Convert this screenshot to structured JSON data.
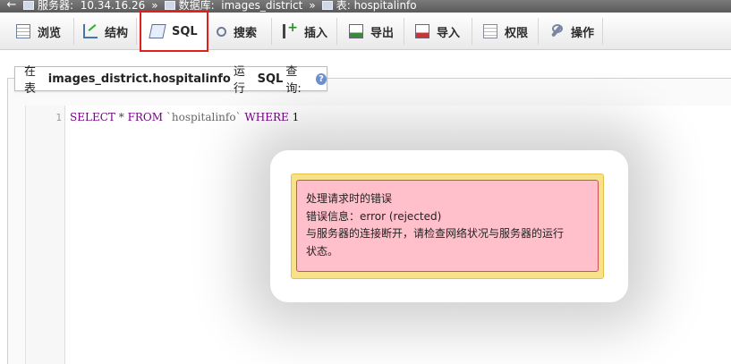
{
  "breadcrumb": {
    "back_arrow": "←",
    "server_label": "服务器:",
    "server_value": "10.34.16.26",
    "separator": "»",
    "db_label": "数据库:",
    "db_value": "images_district",
    "table_label": "表:",
    "table_value": "hospitalinfo"
  },
  "tabs": [
    {
      "label": "浏览",
      "icon": "browse-icon"
    },
    {
      "label": "结构",
      "icon": "structure-icon"
    },
    {
      "label": "SQL",
      "icon": "sql-icon",
      "active": true
    },
    {
      "label": "搜索",
      "icon": "search-icon"
    },
    {
      "label": "插入",
      "icon": "insert-icon"
    },
    {
      "label": "导出",
      "icon": "export-icon"
    },
    {
      "label": "导入",
      "icon": "import-icon"
    },
    {
      "label": "权限",
      "icon": "privileges-icon"
    },
    {
      "label": "操作",
      "icon": "operations-icon"
    }
  ],
  "query_label": {
    "prefix": "在表",
    "table": "images_district.hospitalinfo",
    "suffix": "运行",
    "sql": "SQL",
    "end": "查询:",
    "help": "?"
  },
  "editor": {
    "line_number": "1",
    "kw_select": "SELECT",
    "star": "*",
    "kw_from": "FROM",
    "table": "`hospitalinfo`",
    "kw_where": "WHERE",
    "value": "1"
  },
  "error": {
    "title": "处理请求时的错误",
    "detail": "错误信息：error (rejected)",
    "message_line1": "与服务器的连接断开，请检查网络状况与服务器的运行",
    "message_line2": "状态。"
  },
  "colors": {
    "active_outline": "#e0201a",
    "error_bg": "#ffc0cb",
    "error_frame": "#f7e28a",
    "keyword": "#770088"
  }
}
